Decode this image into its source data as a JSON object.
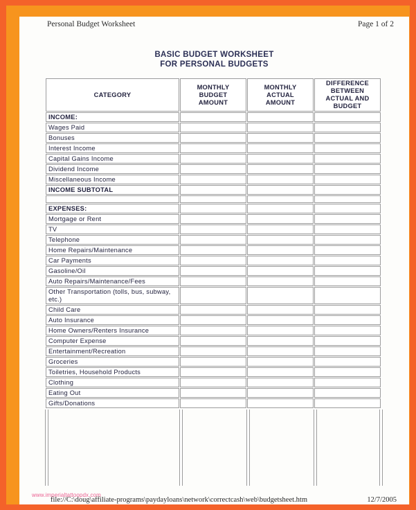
{
  "page": {
    "header_left": "Personal Budget Worksheet",
    "header_right": "Page 1 of 2",
    "title_line1": "BASIC BUDGET WORKSHEET",
    "title_line2": "FOR PERSONAL BUDGETS",
    "watermark": "www.imperialtattoopdx.com",
    "footer_path": "file://C:\\doug\\affiliate-programs\\paydayloans\\network\\correctcash\\web\\budgetsheet.htm",
    "footer_date": "12/7/2005",
    "colors": {
      "frame_outer": "#f4622a",
      "frame_inner": "#f7941e",
      "paper": "#fdfdfb",
      "title_navy": "#2b2f55",
      "grid_gray": "#9b9b9b",
      "watermark_pink": "#e8457f"
    }
  },
  "table": {
    "columns": [
      {
        "key": "category",
        "label": "CATEGORY"
      },
      {
        "key": "budget",
        "label": "MONTHLY\nBUDGET\nAMOUNT",
        "line1": "MONTHLY",
        "line2": "BUDGET",
        "line3": "AMOUNT"
      },
      {
        "key": "actual",
        "label": "MONTHLY\nACTUAL\nAMOUNT",
        "line1": "MONTHLY",
        "line2": "ACTUAL",
        "line3": "AMOUNT"
      },
      {
        "key": "difference",
        "label": "DIFFERENCE\nBETWEEN\nACTUAL AND\nBUDGET",
        "line1": "DIFFERENCE",
        "line2": "BETWEEN",
        "line3": "ACTUAL AND",
        "line4": "BUDGET"
      }
    ],
    "rows": [
      {
        "label": "INCOME:",
        "style": "bold",
        "budget": "",
        "actual": "",
        "difference": ""
      },
      {
        "label": "Wages Paid",
        "style": "normal",
        "budget": "",
        "actual": "",
        "difference": ""
      },
      {
        "label": "Bonuses",
        "style": "normal",
        "budget": "",
        "actual": "",
        "difference": ""
      },
      {
        "label": "Interest Income",
        "style": "normal",
        "budget": "",
        "actual": "",
        "difference": ""
      },
      {
        "label": "Capital Gains Income",
        "style": "normal",
        "budget": "",
        "actual": "",
        "difference": ""
      },
      {
        "label": "Dividend Income",
        "style": "normal",
        "budget": "",
        "actual": "",
        "difference": ""
      },
      {
        "label": "Miscellaneous Income",
        "style": "normal",
        "budget": "",
        "actual": "",
        "difference": ""
      },
      {
        "label": "INCOME SUBTOTAL",
        "style": "bold",
        "budget": "",
        "actual": "",
        "difference": ""
      },
      {
        "label": "",
        "style": "blank",
        "budget": "",
        "actual": "",
        "difference": ""
      },
      {
        "label": "EXPENSES:",
        "style": "bold",
        "budget": "",
        "actual": "",
        "difference": ""
      },
      {
        "label": "Mortgage or Rent",
        "style": "normal",
        "budget": "",
        "actual": "",
        "difference": ""
      },
      {
        "label": "TV",
        "style": "normal",
        "budget": "",
        "actual": "",
        "difference": ""
      },
      {
        "label": "Telephone",
        "style": "normal",
        "budget": "",
        "actual": "",
        "difference": ""
      },
      {
        "label": "Home Repairs/Maintenance",
        "style": "normal",
        "budget": "",
        "actual": "",
        "difference": ""
      },
      {
        "label": "Car Payments",
        "style": "normal",
        "budget": "",
        "actual": "",
        "difference": ""
      },
      {
        "label": "Gasoline/Oil",
        "style": "normal",
        "budget": "",
        "actual": "",
        "difference": ""
      },
      {
        "label": "Auto Repairs/Maintenance/Fees",
        "style": "normal",
        "budget": "",
        "actual": "",
        "difference": ""
      },
      {
        "label": "Other Transportation (tolls, bus, subway, etc.)",
        "style": "tall",
        "budget": "",
        "actual": "",
        "difference": ""
      },
      {
        "label": "Child Care",
        "style": "normal",
        "budget": "",
        "actual": "",
        "difference": ""
      },
      {
        "label": "Auto Insurance",
        "style": "normal",
        "budget": "",
        "actual": "",
        "difference": ""
      },
      {
        "label": "Home Owners/Renters Insurance",
        "style": "normal",
        "budget": "",
        "actual": "",
        "difference": ""
      },
      {
        "label": "Computer Expense",
        "style": "normal",
        "budget": "",
        "actual": "",
        "difference": ""
      },
      {
        "label": "Entertainment/Recreation",
        "style": "normal",
        "budget": "",
        "actual": "",
        "difference": ""
      },
      {
        "label": "Groceries",
        "style": "normal",
        "budget": "",
        "actual": "",
        "difference": ""
      },
      {
        "label": "Toiletries, Household Products",
        "style": "normal",
        "budget": "",
        "actual": "",
        "difference": ""
      },
      {
        "label": "Clothing",
        "style": "normal",
        "budget": "",
        "actual": "",
        "difference": ""
      },
      {
        "label": "Eating Out",
        "style": "normal",
        "budget": "",
        "actual": "",
        "difference": ""
      },
      {
        "label": "Gifts/Donations",
        "style": "normal",
        "budget": "",
        "actual": "",
        "difference": ""
      }
    ]
  }
}
